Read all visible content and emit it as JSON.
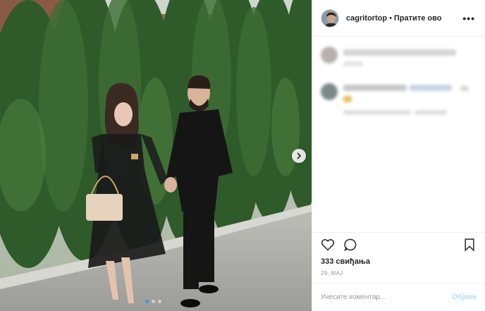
{
  "header": {
    "username": "cagritortop",
    "separator": "•",
    "follow_label": "Пратите ово",
    "more_label": "•••"
  },
  "actions": {
    "likes_text": "333 свиђања",
    "date_text": "29. МАЈ"
  },
  "comment_box": {
    "placeholder": "Унесите коментар...",
    "post_label": "Објави"
  },
  "carousel": {
    "slide_count": 3,
    "active_index": 0
  },
  "colors": {
    "post_button": "#b2dffc",
    "active_dot": "#3897f0",
    "text": "#262626"
  }
}
